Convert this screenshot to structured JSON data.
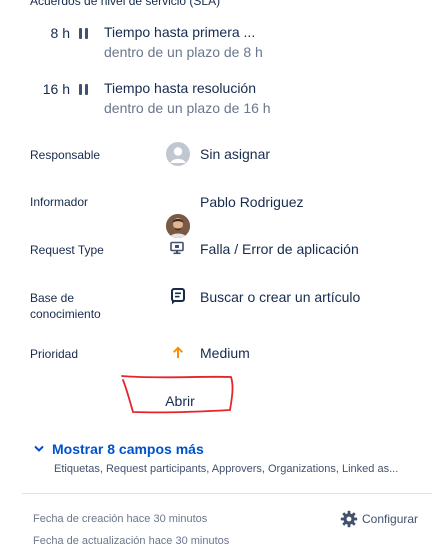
{
  "sla": {
    "title": "Acuerdos de nivel de servicio (SLA)",
    "items": [
      {
        "time": "8 h",
        "name": "Tiempo hasta primera ...",
        "deadline": "dentro de un plazo de 8 h"
      },
      {
        "time": "16 h",
        "name": "Tiempo hasta resolución",
        "deadline": "dentro de un plazo de 16 h"
      }
    ]
  },
  "fields": {
    "assignee": {
      "label": "Responsable",
      "value": "Sin asignar",
      "icon": "default-avatar-icon"
    },
    "reporter": {
      "label": "Informador",
      "value": "Pablo Rodriguez",
      "icon": "user-avatar"
    },
    "request_type": {
      "label": "Request Type",
      "value": "Falla / Error de aplicación",
      "icon": "monitor-icon"
    },
    "knowledge_base": {
      "label_line1": "Base de",
      "label_line2": "conocimiento",
      "value": "Buscar o crear un artículo",
      "icon": "article-icon"
    },
    "priority": {
      "label": "Prioridad",
      "value": "Medium",
      "icon": "arrow-up-icon",
      "icon_color": "#ff8b00"
    }
  },
  "status_button": {
    "label": "Abrir",
    "annotation_color": "#e5252a"
  },
  "more_fields": {
    "label": "Mostrar 8 campos más",
    "summary": "Etiquetas, Request participants, Approvers, Organizations, Linked as..."
  },
  "footer": {
    "created": "Fecha de creación hace 30 minutos",
    "updated": "Fecha de actualización hace 30 minutos",
    "configure_label": "Configurar"
  },
  "colors": {
    "link": "#0052cc",
    "text": "#172b4d",
    "muted": "#6b778c"
  }
}
